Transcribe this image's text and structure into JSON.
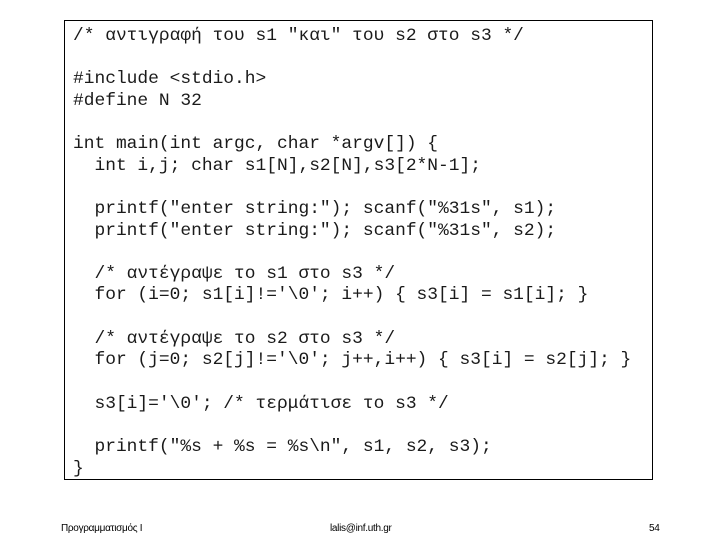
{
  "slide": {
    "code_lines": [
      "/* αντιγραφή του s1 \"και\" του s2 στο s3 */",
      "#include <stdio.h>",
      "#define N 32",
      "int main(int argc, char *argv[]) {",
      "  int i,j; char s1[N],s2[N],s3[2*N-1];",
      "  printf(\"enter string:\"); scanf(\"%31s\", s1);",
      "  printf(\"enter string:\"); scanf(\"%31s\", s2);",
      "  /* αντέγραψε το s1 στο s3 */",
      "  for (i=0; s1[i]!='\\0'; i++) { s3[i] = s1[i]; }",
      "  /* αντέγραψε το s2 στο s3 */",
      "  for (j=0; s2[j]!='\\0'; j++,i++) { s3[i] = s2[j]; }",
      "  s3[i]='\\0'; /* τερμάτισε το s3 */",
      "  printf(\"%s + %s = %s\\n\", s1, s2, s3);",
      "}"
    ]
  },
  "footer": {
    "course": "Προγραμματισμός Ι",
    "email": "lalis@inf.uth.gr",
    "page_number": "54"
  }
}
